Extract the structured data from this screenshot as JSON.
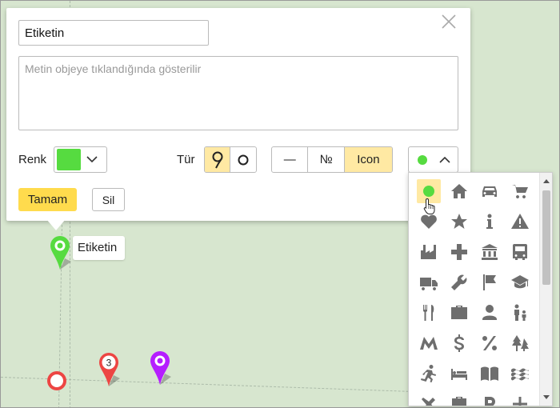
{
  "editor": {
    "title_value": "Etiketin",
    "description_placeholder": "Metin objeye tıklandığında gösterilir",
    "color_label": "Renk",
    "color_value": "#56db40",
    "type_label": "Tür",
    "type_options": [
      "pin",
      "circle"
    ],
    "type_selected": "pin",
    "content_options": [
      "—",
      "№",
      "Icon"
    ],
    "content_selected": "Icon",
    "icon_selected": "dot",
    "ok_label": "Tamam",
    "delete_label": "Sil"
  },
  "icon_picker": {
    "icons": [
      "dot-icon",
      "home-icon",
      "car-icon",
      "cart-icon",
      "heart-icon",
      "star-icon",
      "info-icon",
      "warning-icon",
      "factory-icon",
      "medical-cross-icon",
      "bank-icon",
      "bus-icon",
      "truck-icon",
      "wrench-icon",
      "flag-icon",
      "graduation-cap-icon",
      "restaurant-icon",
      "briefcase-icon",
      "person-icon",
      "family-icon",
      "metro-icon",
      "dollar-icon",
      "percent-icon",
      "trees-icon",
      "runner-icon",
      "bed-icon",
      "book-icon",
      "water-icon",
      "airplane-icon",
      "suitcase-icon",
      "parking-icon",
      "plus-icon"
    ]
  },
  "map": {
    "label_marker_text": "Etiketin",
    "numbered_marker_text": "3",
    "colors": {
      "green": "#56db40",
      "red": "#ed4543",
      "purple": "#b51eff"
    }
  }
}
